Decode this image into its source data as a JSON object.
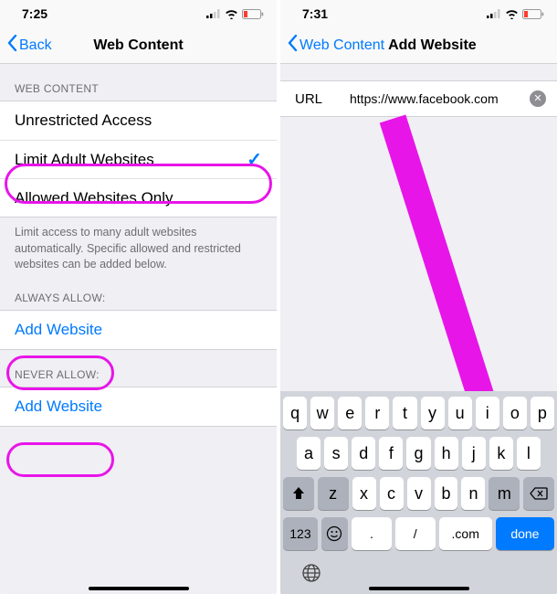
{
  "left": {
    "statusTime": "7:25",
    "back": "Back",
    "title": "Web Content",
    "section1Header": "WEB CONTENT",
    "options": {
      "unrestricted": "Unrestricted Access",
      "limitAdult": "Limit Adult Websites",
      "allowedOnly": "Allowed Websites Only"
    },
    "footer": "Limit access to many adult websites automatically. Specific allowed and restricted websites can be added below.",
    "alwaysAllowHeader": "ALWAYS ALLOW:",
    "neverAllowHeader": "NEVER ALLOW:",
    "addWebsite": "Add Website"
  },
  "right": {
    "statusTime": "7:31",
    "back": "Web Content",
    "title": "Add Website",
    "urlLabel": "URL",
    "urlValue": "https://www.facebook.com",
    "keyboard": {
      "row1": [
        "q",
        "w",
        "e",
        "r",
        "t",
        "y",
        "u",
        "i",
        "o",
        "p"
      ],
      "row2": [
        "a",
        "s",
        "d",
        "f",
        "g",
        "h",
        "j",
        "k",
        "l"
      ],
      "row3": [
        "z",
        "x",
        "c",
        "v",
        "b",
        "n",
        "m"
      ],
      "k123": "123",
      "dot": ".",
      "slash": "/",
      "com": ".com",
      "done": "done"
    }
  }
}
